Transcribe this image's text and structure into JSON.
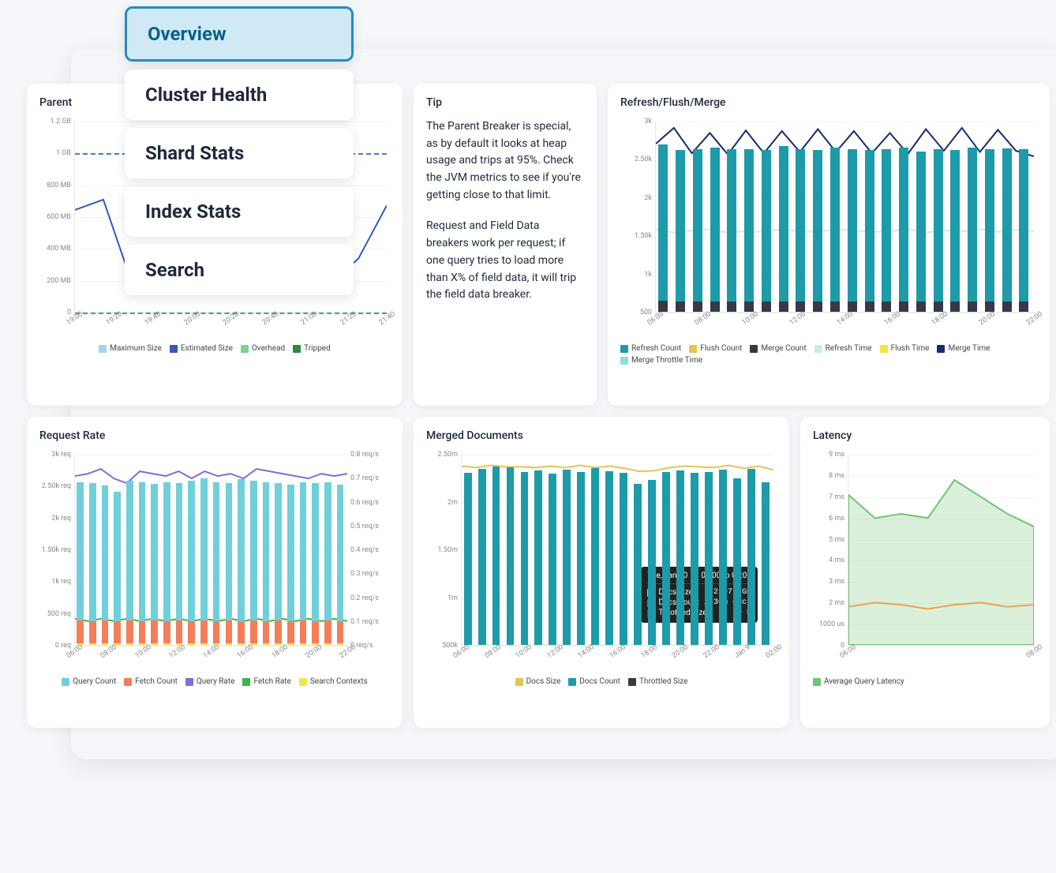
{
  "nav": {
    "items": [
      {
        "label": "Overview",
        "active": true
      },
      {
        "label": "Cluster Health",
        "active": false
      },
      {
        "label": "Shard Stats",
        "active": false
      },
      {
        "label": "Index Stats",
        "active": false
      },
      {
        "label": "Search",
        "active": false
      }
    ]
  },
  "panels": {
    "parent": {
      "title": "Parent"
    },
    "tip": {
      "title": "Tip",
      "p1": "The Parent Breaker is special, as by default it looks at heap usage and trips at 95%. Check the JVM metrics to see if you're getting close to that limit.",
      "p2": "Request and Field Data breakers work per request; if one query tries to load more than X% of field data, it will trip the field data breaker."
    },
    "rfm": {
      "title": "Refresh/Flush/Merge"
    },
    "rr": {
      "title": "Request Rate"
    },
    "md": {
      "title": "Merged Documents"
    },
    "lat": {
      "title": "Latency"
    }
  },
  "tooltip": {
    "date": "Tue, Jan 10",
    "range": "02:00 to 03:00",
    "rows": [
      {
        "label": "Docs Size",
        "color": "#e3c651",
        "value": "2.97  GB"
      },
      {
        "label": "Docs Count",
        "color": "#1e9ba8",
        "value": "2.30m docs"
      },
      {
        "label": "Throttled Size",
        "color": "#444",
        "value": "0 B"
      }
    ]
  },
  "chart_data": [
    {
      "id": "parent",
      "type": "line",
      "title": "Parent",
      "x": [
        "19:00",
        "19:20",
        "19:40",
        "20:00",
        "20:20",
        "20:40",
        "21:00",
        "21:20",
        "21:40"
      ],
      "yticks": [
        "0",
        "200 MB",
        "400 MB",
        "600 MB",
        "800 MB",
        "1 GB",
        "1.2 GB"
      ],
      "ylim_bytes": [
        0,
        1288490188
      ],
      "reference_lines": [
        {
          "name": "Maximum Size",
          "value": 1073741824,
          "color": "#4b78cf",
          "style": "dashed"
        },
        {
          "name": "Overhead",
          "value": 0,
          "color": "#3fb24e",
          "style": "dashed"
        }
      ],
      "series": [
        {
          "name": "Estimated Size",
          "color": "#2f5bbf",
          "style": "line",
          "values": [
            690000000,
            760000000,
            200000000,
            190000000,
            270000000,
            320000000,
            190000000,
            230000000,
            310000000,
            190000000,
            360000000,
            720000000
          ]
        }
      ],
      "legend": [
        "Maximum Size",
        "Estimated Size",
        "Overhead",
        "Tripped"
      ],
      "legend_colors": [
        "#a9d1ed",
        "#2f5bbf",
        "#7fd28b",
        "#2e8b3d"
      ]
    },
    {
      "id": "rfm",
      "type": "bar",
      "title": "Refresh/Flush/Merge",
      "x": [
        "06:00",
        "08:00",
        "10:00",
        "12:00",
        "14:00",
        "16:00",
        "18:00",
        "20:00",
        "22:00"
      ],
      "yticks": [
        "500",
        "1k",
        "1.50k",
        "2k",
        "2.50k",
        "3k"
      ],
      "ylim": [
        0,
        3000
      ],
      "series": [
        {
          "name": "Refresh Count",
          "color": "#1e9ba8",
          "style": "bar",
          "values": [
            2630,
            2540,
            2560,
            2580,
            2550,
            2560,
            2540,
            2600,
            2560,
            2540,
            2580,
            2560,
            2540,
            2560,
            2580,
            2520,
            2560,
            2540,
            2580,
            2560,
            2570,
            2550
          ]
        },
        {
          "name": "Flush Count",
          "color": "#e3c651",
          "style": "bar",
          "values": [
            55,
            50,
            52,
            51,
            50,
            53,
            50,
            52,
            51,
            50,
            52,
            51,
            50,
            52,
            51,
            50,
            52,
            51,
            50,
            52,
            51,
            50
          ]
        },
        {
          "name": "Merge Count",
          "color": "#353a44",
          "style": "bar",
          "values": [
            170,
            160,
            165,
            160,
            158,
            160,
            162,
            160,
            165,
            160,
            162,
            158,
            160,
            162,
            160,
            158,
            160,
            162,
            160,
            165,
            160,
            160
          ]
        },
        {
          "name": "Refresh Time",
          "color": "#c7ecf2",
          "style": "line",
          "values": [
            1300,
            1250,
            1280,
            1300,
            1250,
            1270,
            1260,
            1300,
            1270,
            1260,
            1300,
            1280,
            1260,
            1270,
            1300,
            1250,
            1280,
            1270,
            1300,
            1260,
            1290,
            1270
          ]
        },
        {
          "name": "Flush Time",
          "color": "#f6e24a",
          "style": "line",
          "values": []
        },
        {
          "name": "Merge Time",
          "color": "#1b2a6b",
          "style": "line",
          "values": [
            2650,
            2900,
            2500,
            2820,
            2480,
            2860,
            2500,
            2850,
            2520,
            2880,
            2520,
            2850,
            2500,
            2820,
            2490,
            2880,
            2540,
            2900,
            2520,
            2870,
            2540,
            2450
          ]
        },
        {
          "name": "Merge Throttle Time",
          "color": "#8de0cd",
          "style": "line",
          "values": []
        }
      ],
      "legend": [
        "Refresh Count",
        "Flush Count",
        "Merge Count",
        "Refresh Time",
        "Flush Time",
        "Merge Time",
        "Merge Throttle Time"
      ]
    },
    {
      "id": "rr",
      "type": "bar",
      "title": "Request Rate",
      "x": [
        "06:00",
        "08:00",
        "10:00",
        "12:00",
        "14:00",
        "16:00",
        "18:00",
        "20:00",
        "22:00"
      ],
      "yticks_left": [
        "0 req",
        "500 req",
        "1k req",
        "1.50k req",
        "2k req",
        "2.50k req",
        "3k req"
      ],
      "yticks_right": [
        "0 req/s",
        "0.1 req/s",
        "0.2 req/s",
        "0.3 req/s",
        "0.4 req/s",
        "0.5 req/s",
        "0.6 req/s",
        "0.7 req/s",
        "0.8 req/s"
      ],
      "ylim_left": [
        0,
        3000
      ],
      "ylim_right": [
        0,
        0.8
      ],
      "series": [
        {
          "name": "Query Count",
          "color": "#6fd0d9",
          "style": "bar",
          "axis": "left",
          "values": [
            2560,
            2540,
            2500,
            2400,
            2580,
            2560,
            2530,
            2560,
            2540,
            2580,
            2620,
            2550,
            2540,
            2600,
            2580,
            2560,
            2540,
            2520,
            2550,
            2540,
            2560,
            2520
          ]
        },
        {
          "name": "Fetch Count",
          "color": "#f47e5a",
          "style": "bar",
          "axis": "left",
          "values": [
            380,
            370,
            380,
            370,
            380,
            370,
            380,
            370,
            380,
            370,
            380,
            370,
            380,
            370,
            380,
            370,
            380,
            370,
            380,
            370,
            380,
            370
          ]
        },
        {
          "name": "Query Rate",
          "color": "#7b6fd8",
          "style": "line",
          "axis": "right",
          "values": [
            0.71,
            0.72,
            0.74,
            0.7,
            0.68,
            0.73,
            0.72,
            0.71,
            0.73,
            0.7,
            0.73,
            0.71,
            0.72,
            0.7,
            0.74,
            0.73,
            0.72,
            0.71,
            0.7,
            0.72,
            0.71,
            0.72
          ]
        },
        {
          "name": "Fetch Rate",
          "color": "#3fb24e",
          "style": "line",
          "axis": "right",
          "values": [
            0.11,
            0.1,
            0.11,
            0.1,
            0.11,
            0.1,
            0.11,
            0.1,
            0.11,
            0.1,
            0.11,
            0.1,
            0.11,
            0.1,
            0.11,
            0.1,
            0.11,
            0.1,
            0.11,
            0.1,
            0.11,
            0.1
          ]
        },
        {
          "name": "Search Contexts",
          "color": "#f6e24a",
          "style": "bar",
          "axis": "left",
          "values": [
            30,
            30,
            30,
            30,
            30,
            30,
            30,
            30,
            30,
            30,
            30,
            30,
            30,
            30,
            30,
            30,
            30,
            30,
            30,
            30,
            30,
            30
          ]
        }
      ],
      "legend": [
        "Query Count",
        "Fetch Count",
        "Query Rate",
        "Fetch Rate",
        "Search Contexts"
      ]
    },
    {
      "id": "md",
      "type": "bar",
      "title": "Merged Documents",
      "x": [
        "06:00",
        "08:00",
        "10:00",
        "12:00",
        "14:00",
        "16:00",
        "18:00",
        "20:00",
        "22:00",
        "Jan 9",
        "02:00"
      ],
      "yticks": [
        "500k",
        "1m",
        "1.50m",
        "2m",
        "2.50m"
      ],
      "ylim": [
        0,
        2500000
      ],
      "series": [
        {
          "name": "Docs Size",
          "color": "#e3c651",
          "style": "line",
          "values": [
            2350000,
            2330000,
            2360000,
            2340000,
            2340000,
            2330000,
            2350000,
            2330000,
            2360000,
            2330000,
            2350000,
            2320000,
            2280000,
            2290000,
            2330000,
            2350000,
            2340000,
            2330000,
            2360000,
            2320000,
            2350000,
            2300000
          ]
        },
        {
          "name": "Docs Count",
          "color": "#1e9ba8",
          "style": "bar",
          "values": [
            2250000,
            2300000,
            2340000,
            2320000,
            2260000,
            2280000,
            2240000,
            2290000,
            2260000,
            2310000,
            2270000,
            2250000,
            2110000,
            2160000,
            2260000,
            2280000,
            2250000,
            2260000,
            2290000,
            2180000,
            2300000,
            2130000
          ]
        },
        {
          "name": "Throttled Size",
          "color": "#353a44",
          "style": "bar",
          "values": [
            0,
            0,
            0,
            0,
            0,
            0,
            0,
            0,
            0,
            0,
            0,
            0,
            0,
            0,
            0,
            0,
            0,
            0,
            0,
            0,
            0,
            0
          ]
        }
      ],
      "legend": [
        "Docs Size",
        "Docs Count",
        "Throttled Size"
      ]
    },
    {
      "id": "lat",
      "type": "line",
      "title": "Latency",
      "x": [
        "06:00",
        "08:00"
      ],
      "yticks": [
        "0",
        "1000 us",
        "2 ms",
        "3 ms",
        "4 ms",
        "5 ms",
        "6 ms",
        "7 ms",
        "8 ms",
        "9 ms"
      ],
      "ylim": [
        0,
        9
      ],
      "series": [
        {
          "name": "Average Query Latency",
          "color": "#6fc56f",
          "style": "area",
          "values": [
            7.1,
            6.0,
            6.2,
            6.0,
            7.8,
            7.0,
            6.2,
            5.6
          ]
        },
        {
          "name": "(orange)",
          "color": "#f0a050",
          "style": "line",
          "values": [
            1.8,
            2.0,
            1.9,
            1.7,
            1.9,
            2.0,
            1.8,
            1.9
          ]
        }
      ],
      "legend": [
        "Average Query Latency"
      ]
    }
  ]
}
